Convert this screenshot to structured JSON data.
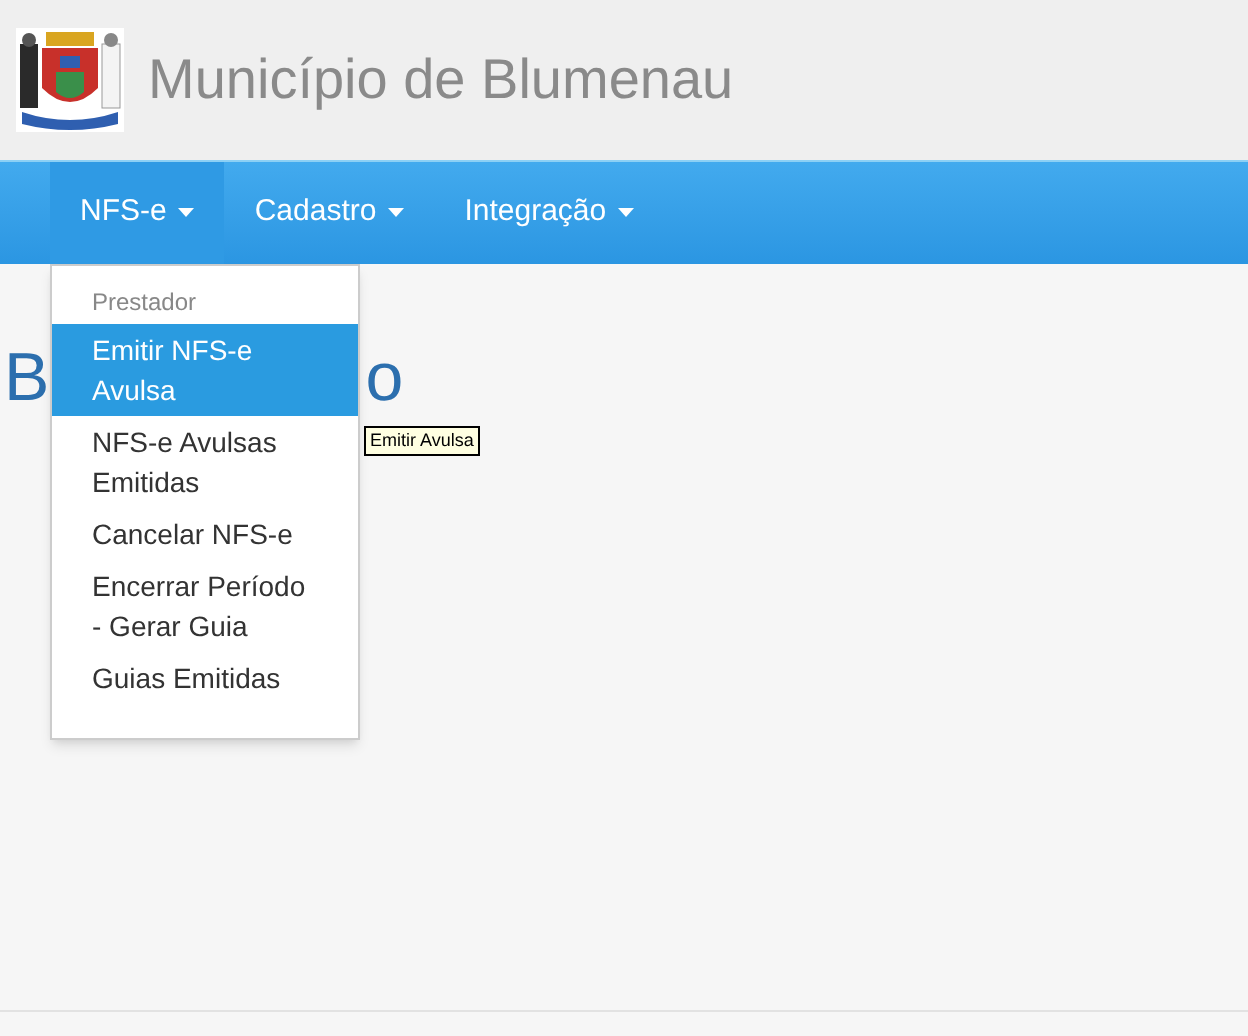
{
  "header": {
    "title": "Município de Blumenau"
  },
  "nav": [
    {
      "label": "NFS-e",
      "expanded": true
    },
    {
      "label": "Cadastro",
      "expanded": false
    },
    {
      "label": "Integração",
      "expanded": false
    }
  ],
  "dropdown": {
    "section": "Prestador",
    "items": [
      {
        "label": "Emitir NFS-e Avulsa",
        "selected": true
      },
      {
        "label": "NFS-e Avulsas Emitidas",
        "selected": false
      },
      {
        "label": "Cancelar NFS-e",
        "selected": false
      },
      {
        "label": "Encerrar Período - Gerar Guia",
        "selected": false
      },
      {
        "label": "Guias Emitidas",
        "selected": false
      }
    ]
  },
  "tooltip": "Emitir Avulsa",
  "heading_fragments": [
    "B",
    "o"
  ]
}
